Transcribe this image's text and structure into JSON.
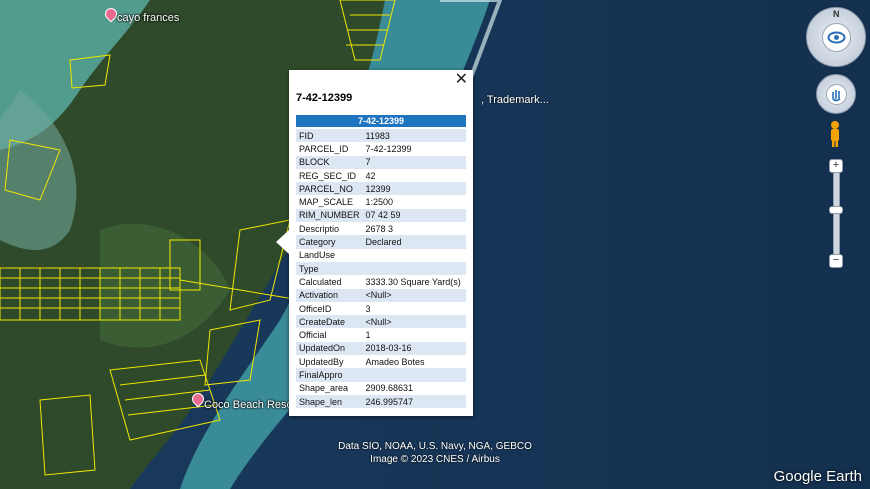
{
  "map": {
    "places": [
      {
        "name": "cayo frances"
      },
      {
        "name": "Coco Beach Reso"
      }
    ],
    "trademark_text": ", Trademark...",
    "attribution_line1": "Data SIO, NOAA, U.S. Navy, NGA, GEBCO",
    "attribution_line2": "Image © 2023 CNES / Airbus",
    "brand": "Google Earth"
  },
  "popup": {
    "title": "7-42-12399",
    "close_glyph": "✕",
    "table_header": "7-42-12399",
    "rows": [
      {
        "key": "FID",
        "value": "11983"
      },
      {
        "key": "PARCEL_ID",
        "value": "7-42-12399"
      },
      {
        "key": "BLOCK",
        "value": "7"
      },
      {
        "key": "REG_SEC_ID",
        "value": "42"
      },
      {
        "key": "PARCEL_NO",
        "value": "12399"
      },
      {
        "key": "MAP_SCALE",
        "value": "1:2500"
      },
      {
        "key": "RIM_NUMBER",
        "value": "07 42 59"
      },
      {
        "key": "Descriptio",
        "value": "2678 3"
      },
      {
        "key": "Category",
        "value": "Declared"
      },
      {
        "key": "LandUse",
        "value": ""
      },
      {
        "key": "Type",
        "value": ""
      },
      {
        "key": "Calculated",
        "value": "3333.30 Square Yard(s)"
      },
      {
        "key": "Activation",
        "value": "<Null>"
      },
      {
        "key": "OfficeID",
        "value": "3"
      },
      {
        "key": "CreateDate",
        "value": "<Null>"
      },
      {
        "key": "Official",
        "value": "1"
      },
      {
        "key": "UpdatedOn",
        "value": "2018-03-16"
      },
      {
        "key": "UpdatedBy",
        "value": "Amadeo Botes"
      },
      {
        "key": "FinalAppro",
        "value": ""
      },
      {
        "key": "Shape_area",
        "value": "2909.68631"
      },
      {
        "key": "Shape_len",
        "value": "246.995747"
      }
    ]
  },
  "controls": {
    "zoom_in": "+",
    "zoom_out": "−"
  }
}
